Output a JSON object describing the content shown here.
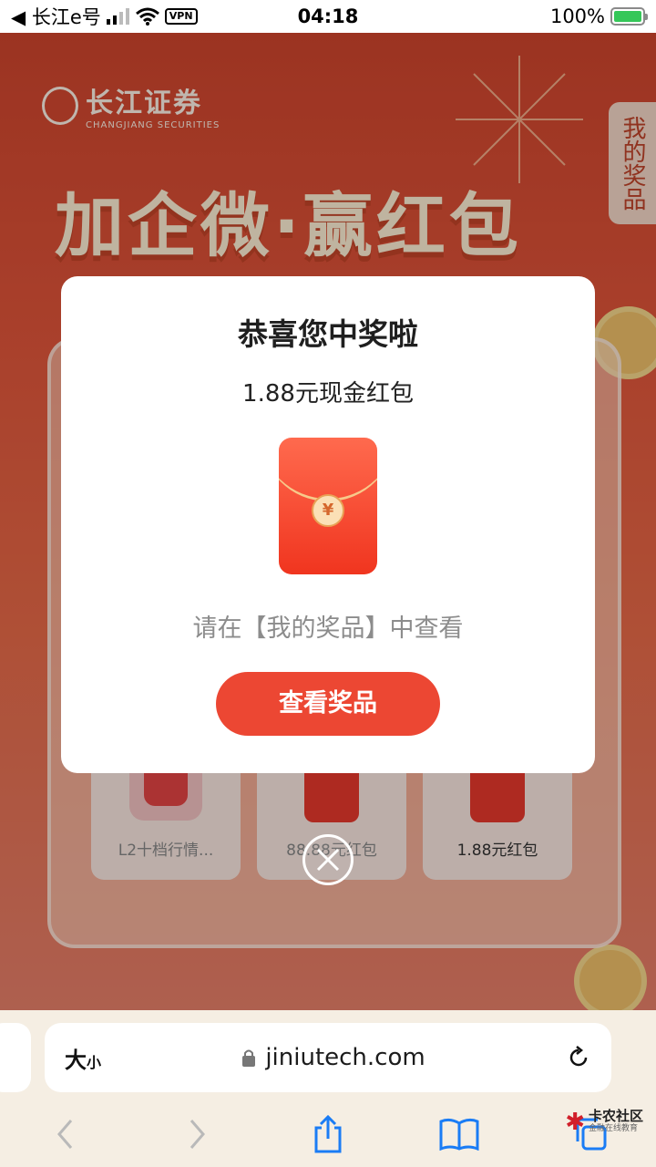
{
  "status_bar": {
    "back_app": "◀ 长江e号",
    "time": "04:18",
    "vpn": "VPN",
    "battery": "100%"
  },
  "page": {
    "logo_cn": "长江证券",
    "logo_en": "CHANGJIANG SECURITIES",
    "headline": "加企微·赢红包",
    "my_prize_tab": "我的奖品",
    "prizes": [
      {
        "label": "L2十档行情..."
      },
      {
        "label": "88.88元红包"
      },
      {
        "label": "1.88元红包"
      }
    ]
  },
  "modal": {
    "title": "恭喜您中奖啦",
    "prize": "1.88元现金红包",
    "seal": "¥",
    "hint": "请在【我的奖品】中查看",
    "button": "查看奖品"
  },
  "browser": {
    "text_size_big": "大",
    "text_size_small": "小",
    "url": "jiniutech.com"
  },
  "watermark": {
    "text": "卡农社区",
    "sub": "金融在线教育"
  }
}
